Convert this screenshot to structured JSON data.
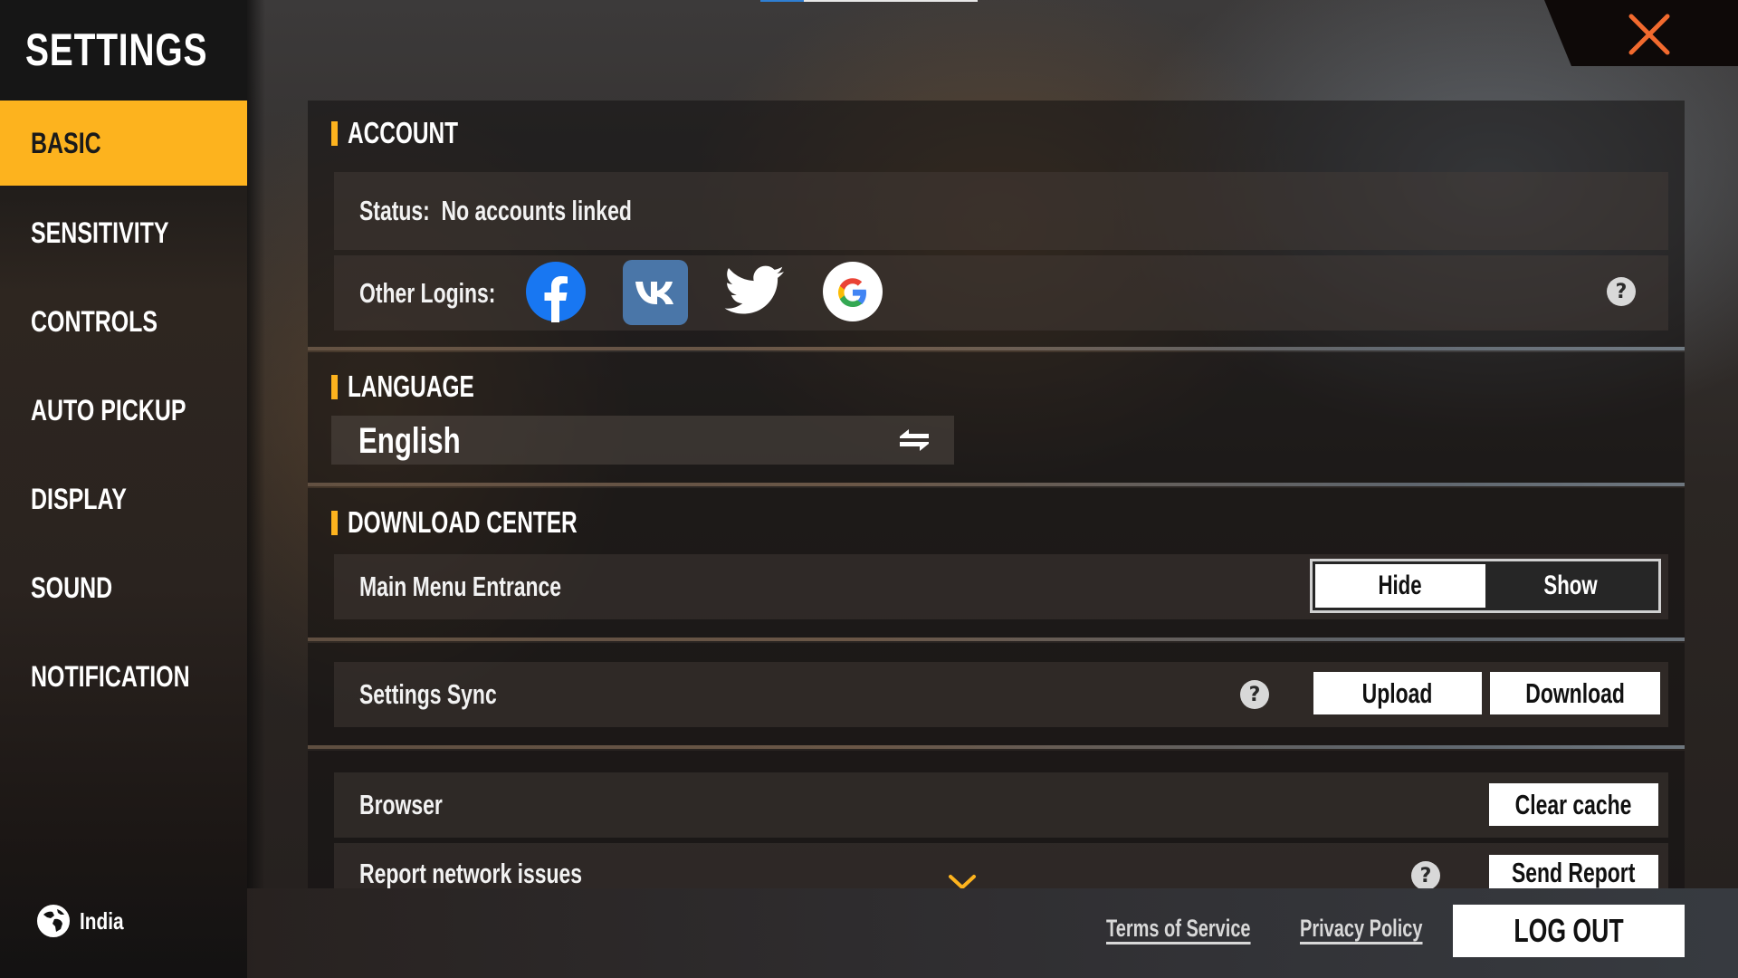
{
  "title": "SETTINGS",
  "sidebar": {
    "items": [
      {
        "label": "BASIC",
        "active": true
      },
      {
        "label": "SENSITIVITY",
        "active": false
      },
      {
        "label": "CONTROLS",
        "active": false
      },
      {
        "label": "AUTO PICKUP",
        "active": false
      },
      {
        "label": "DISPLAY",
        "active": false
      },
      {
        "label": "SOUND",
        "active": false
      },
      {
        "label": "NOTIFICATION",
        "active": false
      }
    ],
    "region": {
      "icon": "globe-icon",
      "label": "India"
    }
  },
  "close": {
    "icon": "close-icon",
    "color": "#f26a2e"
  },
  "account": {
    "header": "ACCOUNT",
    "status_label": "Status:",
    "status_value": "No accounts linked",
    "other_logins_label": "Other Logins:",
    "logins": [
      {
        "name": "Facebook",
        "icon": "facebook-icon",
        "color": "#1877f2"
      },
      {
        "name": "VK",
        "icon": "vk-icon",
        "color": "#4a76a8"
      },
      {
        "name": "Twitter",
        "icon": "twitter-icon",
        "color": "#ffffff"
      },
      {
        "name": "Google",
        "icon": "google-icon",
        "color": "#ffffff"
      }
    ],
    "help": "?"
  },
  "language": {
    "header": "LANGUAGE",
    "value": "English",
    "icon": "swap-icon"
  },
  "download_center": {
    "header": "DOWNLOAD CENTER",
    "main_menu_entrance": {
      "label": "Main Menu Entrance",
      "options": [
        "Hide",
        "Show"
      ],
      "selected": "Hide"
    }
  },
  "settings_sync": {
    "label": "Settings Sync",
    "help": "?",
    "upload": "Upload",
    "download": "Download"
  },
  "browser": {
    "label": "Browser",
    "button": "Clear cache"
  },
  "report": {
    "label": "Report network issues",
    "help": "?",
    "button": "Send Report",
    "expand_icon": "chevron-down-icon"
  },
  "footer": {
    "terms": "Terms of Service",
    "privacy": "Privacy Policy",
    "logout": "LOG OUT"
  },
  "colors": {
    "accent": "#fdb31e",
    "close": "#f26a2e"
  }
}
